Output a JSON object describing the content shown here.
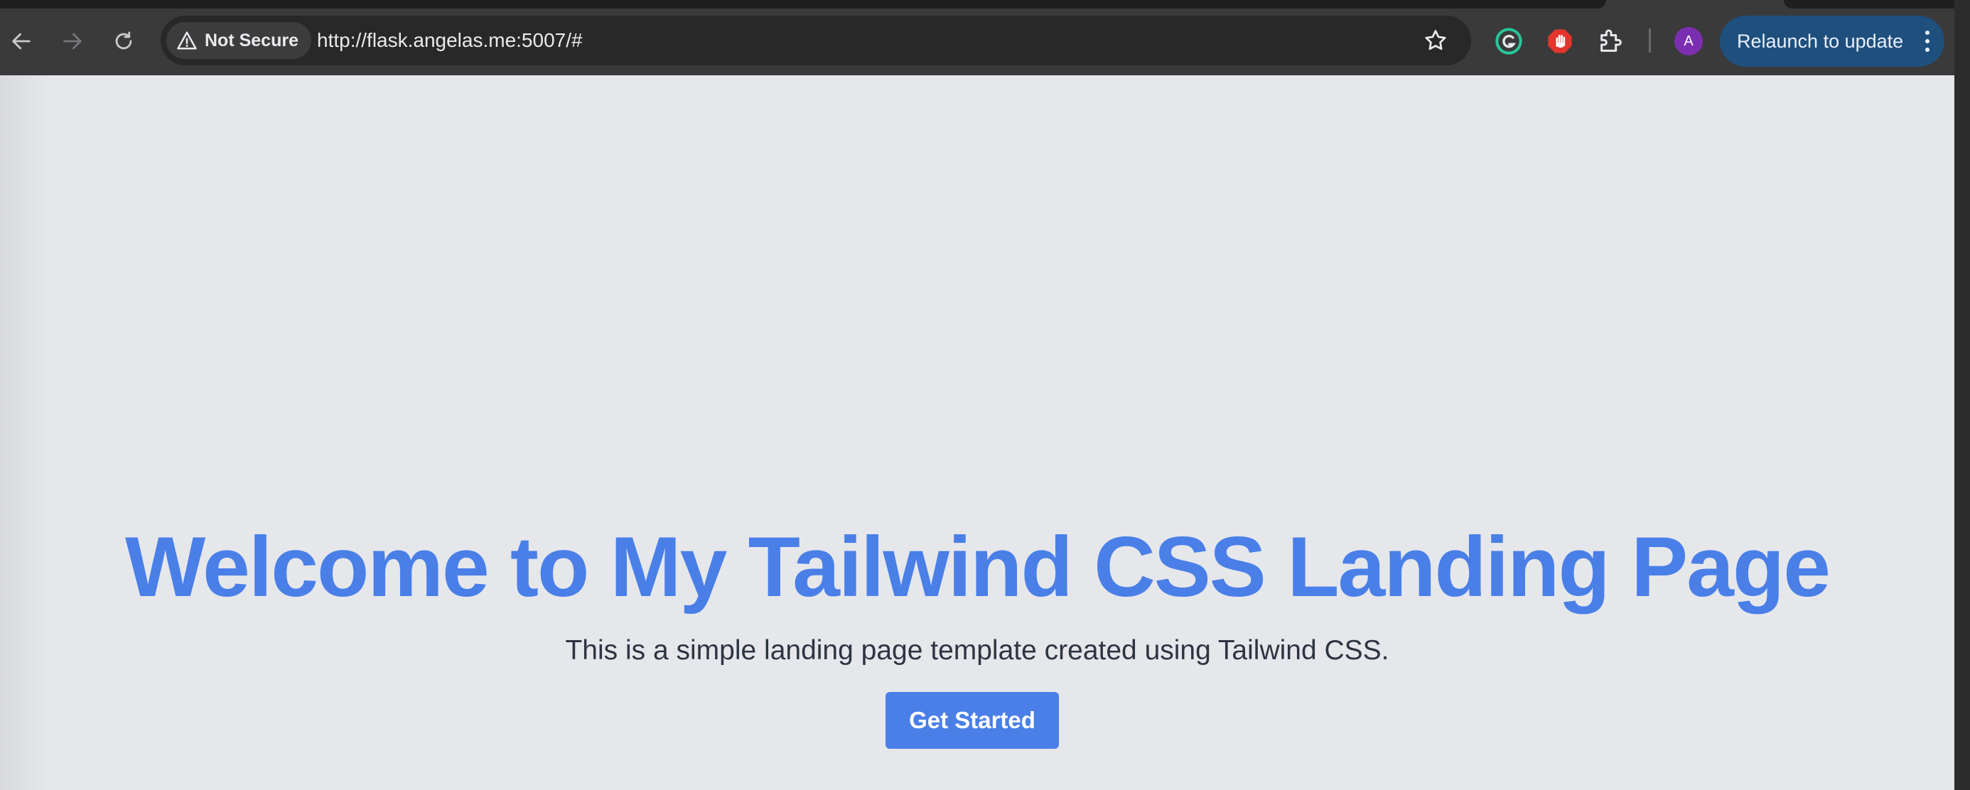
{
  "browser": {
    "security_label": "Not Secure",
    "url": "http://flask.angelas.me:5007/#",
    "profile_initial": "A",
    "relaunch_label": "Relaunch to update",
    "icons": {
      "back": "arrow-left-icon",
      "forward": "arrow-right-icon",
      "reload": "reload-icon",
      "warning": "warning-triangle-icon",
      "bookmark": "star-icon",
      "grammarly": "grammarly-icon",
      "adblock": "stop-hand-icon",
      "extensions": "puzzle-icon",
      "menu": "more-vert-icon"
    }
  },
  "page": {
    "title": "Welcome to My Tailwind CSS Landing Page",
    "subtitle": "This is a simple landing page template created using Tailwind CSS.",
    "cta_label": "Get Started"
  },
  "colors": {
    "page_background": "#e5e7eb",
    "accent": "#4a7fe8",
    "text": "#2e3442",
    "relaunch_background": "#1f4f7c"
  }
}
